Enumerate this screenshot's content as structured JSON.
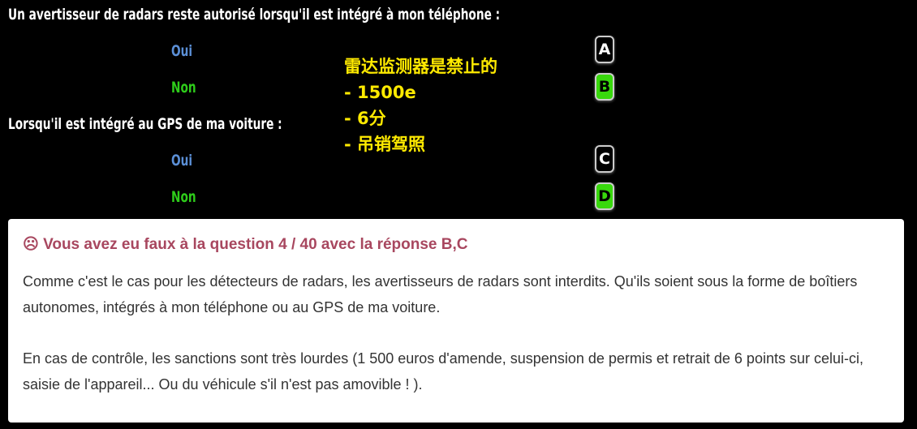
{
  "question": {
    "line1": "Un avertisseur de radars reste autorisé lorsqu'il est intégré à mon téléphone :",
    "line2": "Lorsqu'il est intégré au GPS de ma voiture :",
    "options": [
      {
        "text": "Oui",
        "letter": "A",
        "correct": false
      },
      {
        "text": "Non",
        "letter": "B",
        "correct": true
      },
      {
        "text": "Oui",
        "letter": "C",
        "correct": false
      },
      {
        "text": "Non",
        "letter": "D",
        "correct": true
      }
    ]
  },
  "annotation": {
    "lines": [
      "雷达监测器是禁止的",
      "- 1500e",
      "- 6分",
      "- 吊销驾照"
    ]
  },
  "feedback": {
    "icon": "frown-icon",
    "title": "☹ Vous avez eu faux à la question 4 / 40 avec la réponse B,C",
    "paragraphs": [
      "Comme c'est le cas pour les détecteurs de radars, les avertisseurs de radars sont interdits. Qu'ils soient sous la forme de boîtiers autonomes, intégrés à mon téléphone ou au GPS de ma voiture.",
      "En cas de contrôle, les sanctions sont très lourdes (1 500 euros d'amende, suspension de permis et retrait de 6 points sur celui-ci, saisie de l'appareil... Ou du véhicule s'il n'est pas amovible ! )."
    ]
  },
  "colors": {
    "background": "#000000",
    "oui": "#5b8fd6",
    "non": "#2ecc1a",
    "correct_box": "#38d80d",
    "annotation": "#ffea00",
    "error_title": "#a8475f"
  }
}
